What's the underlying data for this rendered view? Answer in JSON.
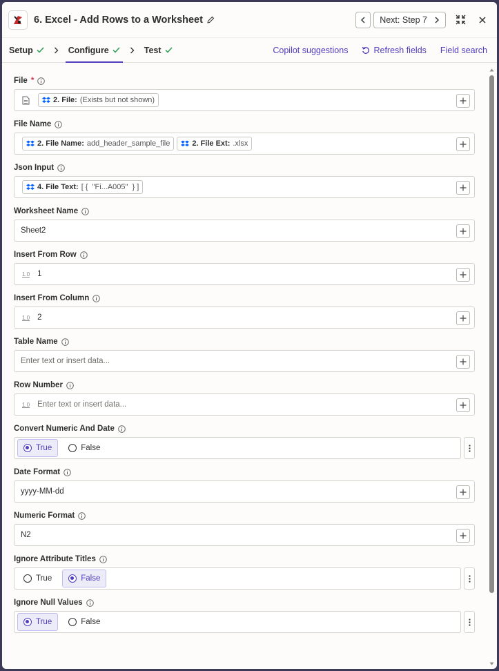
{
  "header": {
    "title": "6. Excel - Add Rows to a Worksheet",
    "next_label": "Next: Step 7"
  },
  "tabs": [
    {
      "label": "Setup",
      "checked": true
    },
    {
      "label": "Configure",
      "checked": true,
      "active": true
    },
    {
      "label": "Test",
      "checked": true
    }
  ],
  "actions": {
    "copilot": "Copilot suggestions",
    "refresh": "Refresh fields",
    "field_search": "Field search"
  },
  "fields": {
    "file": {
      "label": "File",
      "required": "*",
      "pill": {
        "key": "2. File:",
        "value": "(Exists but not shown)"
      }
    },
    "file_name": {
      "label": "File Name",
      "pills": [
        {
          "key": "2. File Name:",
          "value": "add_header_sample_file"
        },
        {
          "key": "2. File Ext:",
          "value": ".xlsx"
        }
      ]
    },
    "json_input": {
      "label": "Json Input",
      "pill": {
        "key": "4. File Text:",
        "value": "[ {  \"Fi...A005\"  } ]"
      }
    },
    "worksheet_name": {
      "label": "Worksheet Name",
      "value": "Sheet2"
    },
    "insert_from_row": {
      "label": "Insert From Row",
      "badge": "1.0",
      "value": "1"
    },
    "insert_from_column": {
      "label": "Insert From Column",
      "badge": "1.0",
      "value": "2"
    },
    "table_name": {
      "label": "Table Name",
      "placeholder": "Enter text or insert data..."
    },
    "row_number": {
      "label": "Row Number",
      "badge": "1.0",
      "placeholder": "Enter text or insert data..."
    },
    "convert_numeric": {
      "label": "Convert Numeric And Date",
      "true_label": "True",
      "false_label": "False",
      "selected": "True"
    },
    "date_format": {
      "label": "Date Format",
      "value": "yyyy-MM-dd"
    },
    "numeric_format": {
      "label": "Numeric Format",
      "value": "N2"
    },
    "ignore_attr_titles": {
      "label": "Ignore Attribute Titles",
      "true_label": "True",
      "false_label": "False",
      "selected": "False"
    },
    "ignore_null": {
      "label": "Ignore Null Values",
      "true_label": "True",
      "false_label": "False",
      "selected": "True"
    }
  },
  "colors": {
    "accent": "#503ebf",
    "check": "#2a9d55",
    "required": "#d1384e",
    "dropbox": "#0061fe"
  }
}
